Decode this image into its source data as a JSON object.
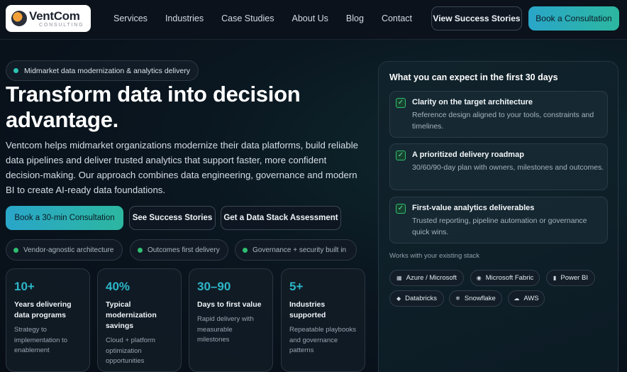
{
  "brand": {
    "name": "VentCom",
    "sub": "CONSULTING"
  },
  "nav": {
    "links": [
      "Services",
      "Industries",
      "Case Studies",
      "About Us",
      "Blog",
      "Contact"
    ],
    "secondary_cta": "View Success Stories",
    "primary_cta": "Book a Consultation"
  },
  "hero": {
    "tag": "Midmarket data modernization & analytics delivery",
    "title": "Transform data into decision advantage.",
    "description": "Ventcom helps midmarket organizations modernize their data platforms, build reliable data pipelines and deliver trusted analytics that support faster, more confident decision-making. Our approach combines data engineering, governance and modern BI to create AI-ready data foundations.",
    "cta_primary": "Book a 30-min Consultation",
    "cta_stories": "See Success Stories",
    "cta_assessment": "Get a Data Stack Assessment",
    "chips": [
      "Vendor-agnostic architecture",
      "Outcomes first delivery",
      "Governance + security built in"
    ]
  },
  "stats": [
    {
      "value": "10+",
      "label": "Years delivering data programs",
      "note": "Strategy to implementation to enablement"
    },
    {
      "value": "40%",
      "label": "Typical modernization savings",
      "note": "Cloud + platform optimization opportunities"
    },
    {
      "value": "30–90",
      "label": "Days to first value",
      "note": "Rapid delivery with measurable milestones"
    },
    {
      "value": "5+",
      "label": "Industries supported",
      "note": "Repeatable playbooks and governance patterns"
    }
  ],
  "panel": {
    "title": "What you can expect in the first 30 days",
    "items": [
      {
        "title": "Clarity on the target architecture",
        "desc": "Reference design aligned to your tools, constraints and timelines."
      },
      {
        "title": "A prioritized delivery roadmap",
        "desc": "30/60/90-day plan with owners, milestones and outcomes."
      },
      {
        "title": "First-value analytics deliverables",
        "desc": "Trusted reporting, pipeline automation or governance quick wins."
      }
    ],
    "stack_label": "Works with your existing stack",
    "stack": [
      {
        "name": "Azure / Microsoft",
        "icon": "grid-icon"
      },
      {
        "name": "Microsoft Fabric",
        "icon": "pin-icon"
      },
      {
        "name": "Power BI",
        "icon": "bars-icon"
      },
      {
        "name": "Databricks",
        "icon": "layers-icon"
      },
      {
        "name": "Snowflake",
        "icon": "snowflake-icon"
      },
      {
        "name": "AWS",
        "icon": "cloud-icon"
      }
    ]
  },
  "colors": {
    "accent_teal": "#2cb7c8",
    "accent_green": "#2fbf71",
    "background": "#0a1620"
  }
}
